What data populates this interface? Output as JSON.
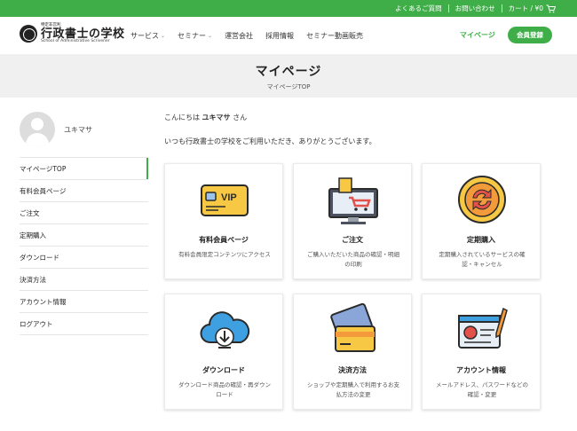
{
  "colors": {
    "brand_green": "#3fae49",
    "band_gray": "#f0f0f0"
  },
  "topbar": {
    "faq": "よくあるご質問",
    "contact": "お問い合わせ",
    "cart": "カート / ¥0",
    "cart_icon": "cart-icon"
  },
  "header": {
    "logo_small": "特定非営利",
    "logo_main": "行政書士の学校",
    "logo_en": "School of Administrative Scrivener",
    "nav": [
      {
        "label": "サービス",
        "has_dropdown": true
      },
      {
        "label": "セミナー",
        "has_dropdown": true
      },
      {
        "label": "運営会社",
        "has_dropdown": false
      },
      {
        "label": "採用情報",
        "has_dropdown": false
      },
      {
        "label": "セミナー動画販売",
        "has_dropdown": false
      }
    ],
    "mypage": "マイページ",
    "signup": "会員登録"
  },
  "band": {
    "title": "マイページ",
    "breadcrumb": "マイページTOP"
  },
  "sidebar": {
    "username": "ユキマサ",
    "items": [
      {
        "label": "マイページTOP",
        "active": true
      },
      {
        "label": "有料会員ページ",
        "active": false
      },
      {
        "label": "ご注文",
        "active": false
      },
      {
        "label": "定期購入",
        "active": false
      },
      {
        "label": "ダウンロード",
        "active": false
      },
      {
        "label": "決済方法",
        "active": false
      },
      {
        "label": "アカウント情報",
        "active": false
      },
      {
        "label": "ログアウト",
        "active": false
      }
    ]
  },
  "main": {
    "greeting_prefix": "こんにちは ",
    "greeting_name": "ユキマサ",
    "greeting_suffix": " さん",
    "welcome": "いつも行政書士の学校をご利用いただき、ありがとうございます。",
    "cards": [
      {
        "title": "有料会員ページ",
        "desc": "有料会員限定コンテンツにアクセス",
        "icon": "vip-card-icon"
      },
      {
        "title": "ご注文",
        "desc": "ご購入いただいた商品の確認・明細の印刷",
        "icon": "shopping-monitor-icon"
      },
      {
        "title": "定期購入",
        "desc": "定期購入されているサービスの確認・キャンセル",
        "icon": "repeat-icon"
      },
      {
        "title": "ダウンロード",
        "desc": "ダウンロード商品の確認・再ダウンロード",
        "icon": "cloud-download-icon"
      },
      {
        "title": "決済方法",
        "desc": "ショップや定期購入で利用するお支払方法の変更",
        "icon": "credit-card-icon"
      },
      {
        "title": "アカウント情報",
        "desc": "メールアドレス、パスワードなどの確認・変更",
        "icon": "id-card-icon"
      }
    ]
  }
}
